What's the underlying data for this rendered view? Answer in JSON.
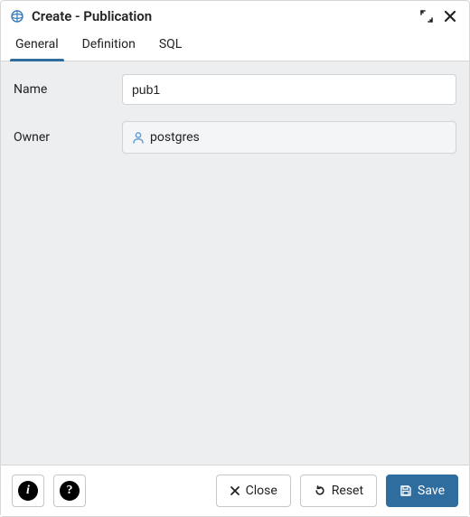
{
  "window": {
    "title": "Create - Publication"
  },
  "tabs": [
    {
      "label": "General",
      "active": true
    },
    {
      "label": "Definition",
      "active": false
    },
    {
      "label": "SQL",
      "active": false
    }
  ],
  "form": {
    "name_label": "Name",
    "name_value": "pub1",
    "owner_label": "Owner",
    "owner_value": "postgres"
  },
  "footer": {
    "close_label": "Close",
    "reset_label": "Reset",
    "save_label": "Save"
  },
  "icons": {
    "info_char": "i",
    "help_char": "?"
  }
}
